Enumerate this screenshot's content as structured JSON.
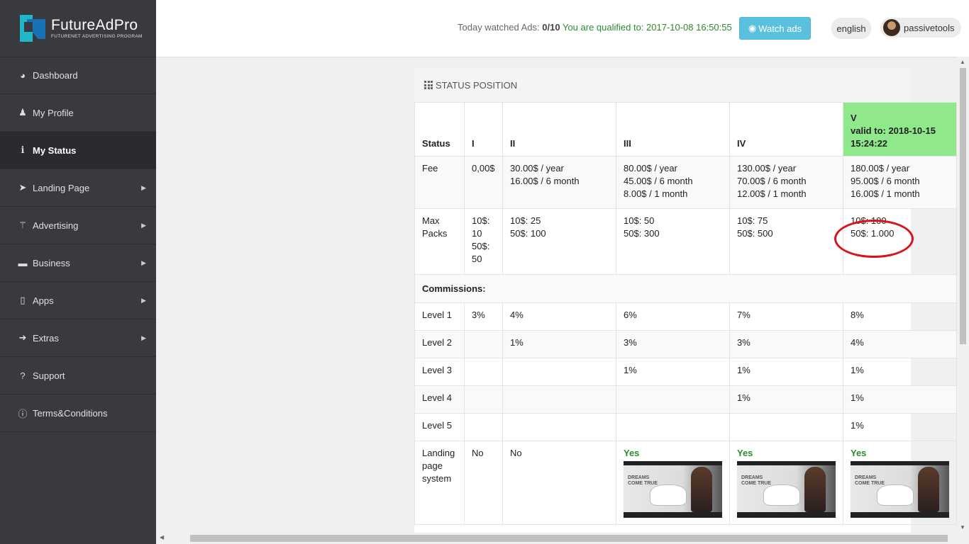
{
  "app": {
    "brand": "FutureAdPro",
    "tagline": "FUTURENET ADVERTISING PROGRAM"
  },
  "sidebar": {
    "items": [
      {
        "label": "Dashboard",
        "icon": "dashboard-icon",
        "glyph": "◕",
        "arrow": false,
        "active": false
      },
      {
        "label": "My Profile",
        "icon": "user-icon",
        "glyph": "♟",
        "arrow": false,
        "active": false
      },
      {
        "label": "My Status",
        "icon": "info-icon",
        "glyph": "ℹ",
        "arrow": false,
        "active": true
      },
      {
        "label": "Landing Page",
        "icon": "paper-plane-icon",
        "glyph": "➤",
        "arrow": true,
        "active": false
      },
      {
        "label": "Advertising",
        "icon": "magic-wand-icon",
        "glyph": "⚚",
        "arrow": true,
        "active": false
      },
      {
        "label": "Business",
        "icon": "briefcase-icon",
        "glyph": "▬",
        "arrow": true,
        "active": false
      },
      {
        "label": "Apps",
        "icon": "mobile-icon",
        "glyph": "▯",
        "arrow": true,
        "active": false
      },
      {
        "label": "Extras",
        "icon": "sign-out-icon",
        "glyph": "➜",
        "arrow": true,
        "active": false
      },
      {
        "label": "Support",
        "icon": "question-icon",
        "glyph": "?",
        "arrow": false,
        "active": false
      },
      {
        "label": "Terms&Conditions",
        "icon": "info-circle-icon",
        "glyph": "ⓘ",
        "arrow": false,
        "active": false
      }
    ],
    "arrow_glyph": "▶"
  },
  "header": {
    "watched_label": "Today watched Ads:",
    "watched_value": "0/10",
    "qualified_text": "You are qualified to: 2017-10-08 16:50:55",
    "watch_button": "Watch ads",
    "language": "english",
    "username": "passivetools"
  },
  "panel": {
    "title": "STATUS POSITION"
  },
  "table": {
    "headers": [
      "Status",
      "I",
      "II",
      "III",
      "IV"
    ],
    "header_v": [
      "V",
      "valid to: 2018-10-15",
      "15:24:22"
    ],
    "fee": {
      "label": "Fee",
      "I": [
        "0,00$"
      ],
      "II": [
        "30.00$ / year",
        "16.00$ / 6 month"
      ],
      "III": [
        "80.00$ / year",
        "45.00$ / 6 month",
        "8.00$ / 1 month"
      ],
      "IV": [
        "130.00$ / year",
        "70.00$ / 6 month",
        "12.00$ / 1 month"
      ],
      "V": [
        "180.00$ / year",
        "95.00$ / 6 month",
        "16.00$ / 1 month"
      ]
    },
    "max_packs": {
      "label": [
        "Max",
        "Packs"
      ],
      "I": [
        "10$:",
        "10",
        "50$:",
        "50"
      ],
      "II": [
        "10$: 25",
        "50$: 100"
      ],
      "III": [
        "10$: 50",
        "50$: 300"
      ],
      "IV": [
        "10$: 75",
        "50$: 500"
      ],
      "V": [
        "10$: 100",
        "50$: 1.000"
      ]
    },
    "commissions_label": "Commissions:",
    "levels": [
      {
        "label": "Level 1",
        "values": [
          "3%",
          "4%",
          "6%",
          "7%",
          "8%"
        ]
      },
      {
        "label": "Level 2",
        "values": [
          "",
          "1%",
          "3%",
          "3%",
          "4%"
        ]
      },
      {
        "label": "Level 3",
        "values": [
          "",
          "",
          "1%",
          "1%",
          "1%"
        ]
      },
      {
        "label": "Level 4",
        "values": [
          "",
          "",
          "",
          "1%",
          "1%"
        ]
      },
      {
        "label": "Level 5",
        "values": [
          "",
          "",
          "",
          "",
          "1%"
        ]
      }
    ],
    "landing": {
      "label": [
        "Landing",
        "page",
        "system"
      ],
      "values": [
        "No",
        "No",
        "Yes",
        "Yes",
        "Yes"
      ],
      "thumb_text": [
        "DREAMS",
        "COME TRUE"
      ]
    }
  },
  "colors": {
    "highlight": "#8fe88a",
    "yes": "#2f8a2f",
    "annotation": "#d8141a",
    "sidebar": "#393a3e"
  }
}
